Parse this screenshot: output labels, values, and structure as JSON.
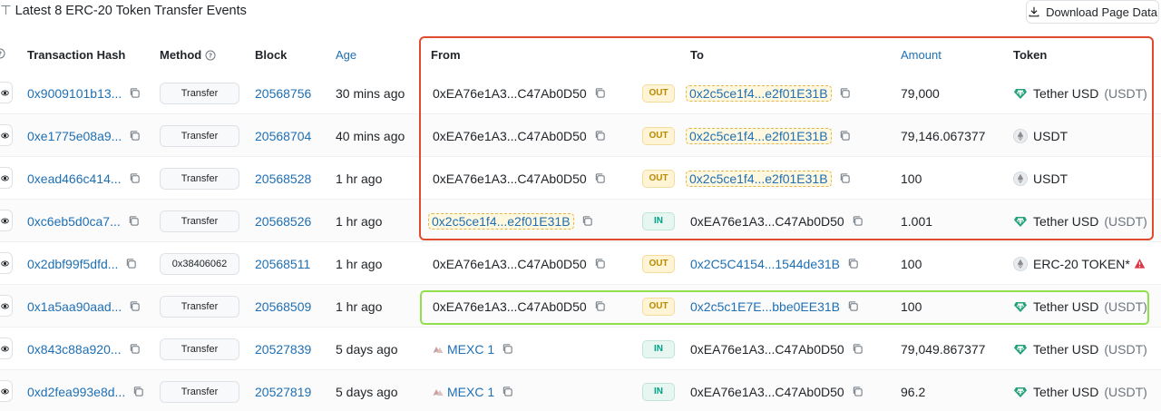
{
  "header": {
    "title": "Latest 8 ERC-20 Token Transfer Events",
    "download_label": "Download Page Data"
  },
  "columns": {
    "tx_hash": "Transaction Hash",
    "method": "Method",
    "block": "Block",
    "age": "Age",
    "from": "From",
    "to": "To",
    "amount": "Amount",
    "token": "Token"
  },
  "rows": [
    {
      "hash": "0x9009101b13...",
      "method": "Transfer",
      "block": "20568756",
      "age": "30 mins ago",
      "from": "0xEA76e1A3...C47Ab0D50",
      "dir": "OUT",
      "to": "0x2c5ce1f4...e2f01E31B",
      "amount": "79,000",
      "token_name": "Tether USD",
      "token_symbol": "(USDT)"
    },
    {
      "hash": "0xe1775e08a9...",
      "method": "Transfer",
      "block": "20568704",
      "age": "40 mins ago",
      "from": "0xEA76e1A3...C47Ab0D50",
      "dir": "OUT",
      "to": "0x2c5ce1f4...e2f01E31B",
      "amount": "79,146.067377",
      "token_name": "USDT",
      "token_symbol": ""
    },
    {
      "hash": "0xead466c414...",
      "method": "Transfer",
      "block": "20568528",
      "age": "1 hr ago",
      "from": "0xEA76e1A3...C47Ab0D50",
      "dir": "OUT",
      "to": "0x2c5ce1f4...e2f01E31B",
      "amount": "100",
      "token_name": "USDT",
      "token_symbol": ""
    },
    {
      "hash": "0xc6eb5d0ca7...",
      "method": "Transfer",
      "block": "20568526",
      "age": "1 hr ago",
      "from": "0x2c5ce1f4...e2f01E31B",
      "dir": "IN",
      "to": "0xEA76e1A3...C47Ab0D50",
      "amount": "1.001",
      "token_name": "Tether USD",
      "token_symbol": "(USDT)"
    },
    {
      "hash": "0x2dbf99f5dfd...",
      "method": "0x38406062",
      "block": "20568511",
      "age": "1 hr ago",
      "from": "0xEA76e1A3...C47Ab0D50",
      "dir": "OUT",
      "to": "0x2C5C4154...1544de31B",
      "amount": "100",
      "token_name": "ERC-20 TOKEN*",
      "token_symbol": ""
    },
    {
      "hash": "0x1a5aa90aad...",
      "method": "Transfer",
      "block": "20568509",
      "age": "1 hr ago",
      "from": "0xEA76e1A3...C47Ab0D50",
      "dir": "OUT",
      "to": "0x2c5c1E7E...bbe0EE31B",
      "amount": "100",
      "token_name": "Tether USD",
      "token_symbol": "(USDT)"
    },
    {
      "hash": "0x843c88a920...",
      "method": "Transfer",
      "block": "20527839",
      "age": "5 days ago",
      "from": "MEXC 1",
      "dir": "IN",
      "to": "0xEA76e1A3...C47Ab0D50",
      "amount": "79,049.867377",
      "token_name": "Tether USD",
      "token_symbol": "(USDT)"
    },
    {
      "hash": "0xd2fea993e8d...",
      "method": "Transfer",
      "block": "20527819",
      "age": "5 days ago",
      "from": "MEXC 1",
      "dir": "IN",
      "to": "0xEA76e1A3...C47Ab0D50",
      "amount": "96.2",
      "token_name": "Tether USD",
      "token_symbol": "(USDT)"
    }
  ],
  "colors": {
    "link": "#1e6fb3",
    "out_badge": "#b88a00",
    "in_badge": "#00a186",
    "highlight_red": "#e04a2f",
    "highlight_green": "#8fe04a",
    "tether": "#26a17b"
  }
}
